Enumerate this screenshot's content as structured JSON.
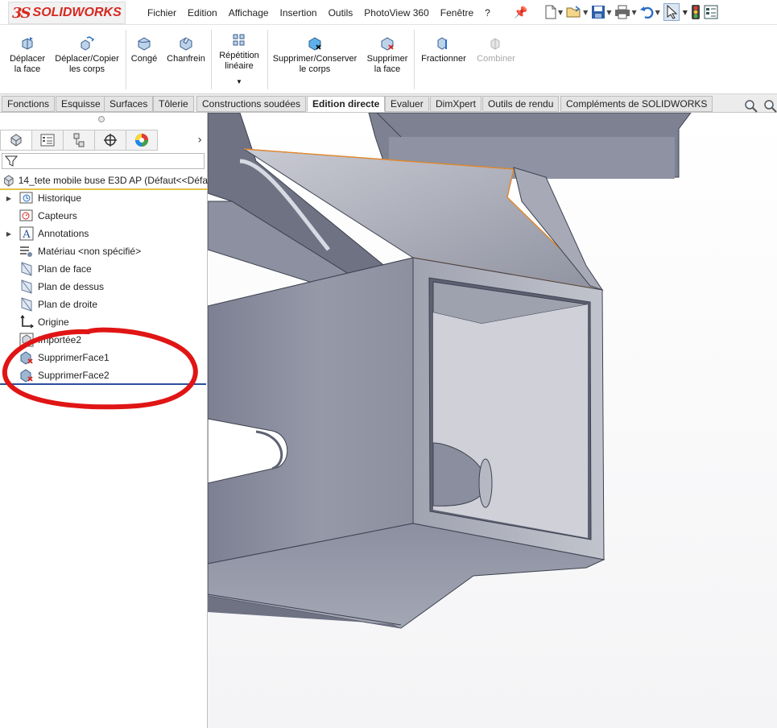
{
  "app": {
    "logo_mark": "3S",
    "logo_text": "SOLIDWORKS"
  },
  "menu": {
    "items": [
      "Fichier",
      "Edition",
      "Affichage",
      "Insertion",
      "Outils",
      "PhotoView 360",
      "Fenêtre",
      "?"
    ]
  },
  "ribbon": {
    "deplacer_face": [
      "Déplacer",
      "la face"
    ],
    "deplacer_copier": [
      "Déplacer/Copier",
      "les corps"
    ],
    "conge": [
      "Congé"
    ],
    "chanfrein": [
      "Chanfrein"
    ],
    "repetition": [
      "Répétition",
      "linéaire"
    ],
    "supprimer_conserver": [
      "Supprimer/Conserver",
      "le corps"
    ],
    "supprimer_face": [
      "Supprimer",
      "la face"
    ],
    "fractionner": [
      "Fractionner"
    ],
    "combiner": [
      "Combiner"
    ]
  },
  "tabs": [
    "Fonctions",
    "Esquisse",
    "Surfaces",
    "Tôlerie",
    "Constructions soudées",
    "Edition directe",
    "Evaluer",
    "DimXpert",
    "Outils de rendu",
    "Compléments de SOLIDWORKS"
  ],
  "active_tab": "Edition directe",
  "tree": {
    "root_label": "14_tete mobile buse E3D AP  (Défaut<<Défa",
    "items": [
      {
        "label": "Historique",
        "icon": "history-icon",
        "expandable": true
      },
      {
        "label": "Capteurs",
        "icon": "sensor-icon",
        "expandable": false
      },
      {
        "label": "Annotations",
        "icon": "annotation-icon",
        "expandable": true
      },
      {
        "label": "Matériau <non spécifié>",
        "icon": "material-icon",
        "expandable": false
      },
      {
        "label": "Plan de face",
        "icon": "plane-icon",
        "expandable": false
      },
      {
        "label": "Plan de dessus",
        "icon": "plane-icon",
        "expandable": false
      },
      {
        "label": "Plan de droite",
        "icon": "plane-icon",
        "expandable": false
      },
      {
        "label": "Origine",
        "icon": "origin-icon",
        "expandable": false
      },
      {
        "label": "Importée2",
        "icon": "imported-body-icon",
        "expandable": false
      },
      {
        "label": "SupprimerFace1",
        "icon": "delete-face-icon",
        "expandable": false
      },
      {
        "label": "SupprimerFace2",
        "icon": "delete-face-icon",
        "expandable": false
      }
    ]
  },
  "colors": {
    "logo_red": "#d7281f",
    "annotation_red": "#e01515",
    "rollback_bar": "#2b4f9e",
    "edge_orange": "#e2892c",
    "model_gray": "#8e93a3"
  }
}
